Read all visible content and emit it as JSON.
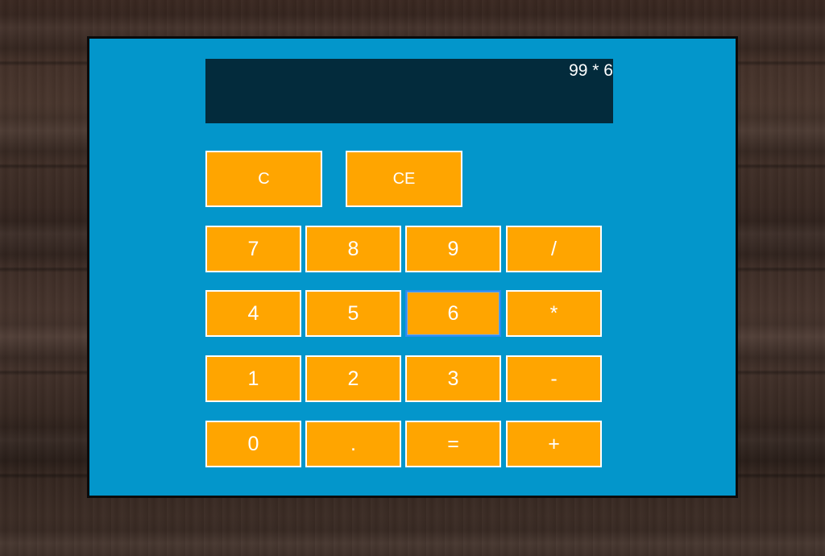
{
  "display": {
    "value": "99 * 6"
  },
  "buttons": {
    "clear": "C",
    "clear_entry": "CE",
    "seven": "7",
    "eight": "8",
    "nine": "9",
    "divide": "/",
    "four": "4",
    "five": "5",
    "six": "6",
    "multiply": "*",
    "one": "1",
    "two": "2",
    "three": "3",
    "subtract": "-",
    "zero": "0",
    "decimal": ".",
    "equals": "=",
    "add": "+"
  },
  "colors": {
    "calculator_body": "#0396cb",
    "display_background": "#032b3c",
    "button_fill": "#ffa500",
    "button_text": "#ffffff",
    "focus_ring": "#2d8cf0"
  },
  "focused_button": "6"
}
